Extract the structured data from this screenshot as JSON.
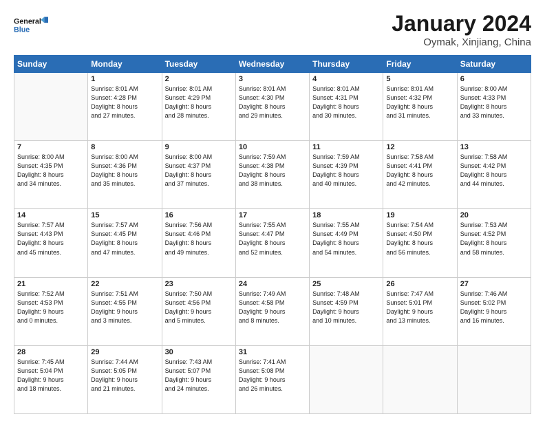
{
  "header": {
    "logo_line1": "General",
    "logo_line2": "Blue",
    "month_title": "January 2024",
    "location": "Oymak, Xinjiang, China"
  },
  "days_of_week": [
    "Sunday",
    "Monday",
    "Tuesday",
    "Wednesday",
    "Thursday",
    "Friday",
    "Saturday"
  ],
  "weeks": [
    [
      {
        "num": "",
        "info": ""
      },
      {
        "num": "1",
        "info": "Sunrise: 8:01 AM\nSunset: 4:28 PM\nDaylight: 8 hours\nand 27 minutes."
      },
      {
        "num": "2",
        "info": "Sunrise: 8:01 AM\nSunset: 4:29 PM\nDaylight: 8 hours\nand 28 minutes."
      },
      {
        "num": "3",
        "info": "Sunrise: 8:01 AM\nSunset: 4:30 PM\nDaylight: 8 hours\nand 29 minutes."
      },
      {
        "num": "4",
        "info": "Sunrise: 8:01 AM\nSunset: 4:31 PM\nDaylight: 8 hours\nand 30 minutes."
      },
      {
        "num": "5",
        "info": "Sunrise: 8:01 AM\nSunset: 4:32 PM\nDaylight: 8 hours\nand 31 minutes."
      },
      {
        "num": "6",
        "info": "Sunrise: 8:00 AM\nSunset: 4:33 PM\nDaylight: 8 hours\nand 33 minutes."
      }
    ],
    [
      {
        "num": "7",
        "info": "Sunrise: 8:00 AM\nSunset: 4:35 PM\nDaylight: 8 hours\nand 34 minutes."
      },
      {
        "num": "8",
        "info": "Sunrise: 8:00 AM\nSunset: 4:36 PM\nDaylight: 8 hours\nand 35 minutes."
      },
      {
        "num": "9",
        "info": "Sunrise: 8:00 AM\nSunset: 4:37 PM\nDaylight: 8 hours\nand 37 minutes."
      },
      {
        "num": "10",
        "info": "Sunrise: 7:59 AM\nSunset: 4:38 PM\nDaylight: 8 hours\nand 38 minutes."
      },
      {
        "num": "11",
        "info": "Sunrise: 7:59 AM\nSunset: 4:39 PM\nDaylight: 8 hours\nand 40 minutes."
      },
      {
        "num": "12",
        "info": "Sunrise: 7:58 AM\nSunset: 4:41 PM\nDaylight: 8 hours\nand 42 minutes."
      },
      {
        "num": "13",
        "info": "Sunrise: 7:58 AM\nSunset: 4:42 PM\nDaylight: 8 hours\nand 44 minutes."
      }
    ],
    [
      {
        "num": "14",
        "info": "Sunrise: 7:57 AM\nSunset: 4:43 PM\nDaylight: 8 hours\nand 45 minutes."
      },
      {
        "num": "15",
        "info": "Sunrise: 7:57 AM\nSunset: 4:45 PM\nDaylight: 8 hours\nand 47 minutes."
      },
      {
        "num": "16",
        "info": "Sunrise: 7:56 AM\nSunset: 4:46 PM\nDaylight: 8 hours\nand 49 minutes."
      },
      {
        "num": "17",
        "info": "Sunrise: 7:55 AM\nSunset: 4:47 PM\nDaylight: 8 hours\nand 52 minutes."
      },
      {
        "num": "18",
        "info": "Sunrise: 7:55 AM\nSunset: 4:49 PM\nDaylight: 8 hours\nand 54 minutes."
      },
      {
        "num": "19",
        "info": "Sunrise: 7:54 AM\nSunset: 4:50 PM\nDaylight: 8 hours\nand 56 minutes."
      },
      {
        "num": "20",
        "info": "Sunrise: 7:53 AM\nSunset: 4:52 PM\nDaylight: 8 hours\nand 58 minutes."
      }
    ],
    [
      {
        "num": "21",
        "info": "Sunrise: 7:52 AM\nSunset: 4:53 PM\nDaylight: 9 hours\nand 0 minutes."
      },
      {
        "num": "22",
        "info": "Sunrise: 7:51 AM\nSunset: 4:55 PM\nDaylight: 9 hours\nand 3 minutes."
      },
      {
        "num": "23",
        "info": "Sunrise: 7:50 AM\nSunset: 4:56 PM\nDaylight: 9 hours\nand 5 minutes."
      },
      {
        "num": "24",
        "info": "Sunrise: 7:49 AM\nSunset: 4:58 PM\nDaylight: 9 hours\nand 8 minutes."
      },
      {
        "num": "25",
        "info": "Sunrise: 7:48 AM\nSunset: 4:59 PM\nDaylight: 9 hours\nand 10 minutes."
      },
      {
        "num": "26",
        "info": "Sunrise: 7:47 AM\nSunset: 5:01 PM\nDaylight: 9 hours\nand 13 minutes."
      },
      {
        "num": "27",
        "info": "Sunrise: 7:46 AM\nSunset: 5:02 PM\nDaylight: 9 hours\nand 16 minutes."
      }
    ],
    [
      {
        "num": "28",
        "info": "Sunrise: 7:45 AM\nSunset: 5:04 PM\nDaylight: 9 hours\nand 18 minutes."
      },
      {
        "num": "29",
        "info": "Sunrise: 7:44 AM\nSunset: 5:05 PM\nDaylight: 9 hours\nand 21 minutes."
      },
      {
        "num": "30",
        "info": "Sunrise: 7:43 AM\nSunset: 5:07 PM\nDaylight: 9 hours\nand 24 minutes."
      },
      {
        "num": "31",
        "info": "Sunrise: 7:41 AM\nSunset: 5:08 PM\nDaylight: 9 hours\nand 26 minutes."
      },
      {
        "num": "",
        "info": ""
      },
      {
        "num": "",
        "info": ""
      },
      {
        "num": "",
        "info": ""
      }
    ]
  ]
}
